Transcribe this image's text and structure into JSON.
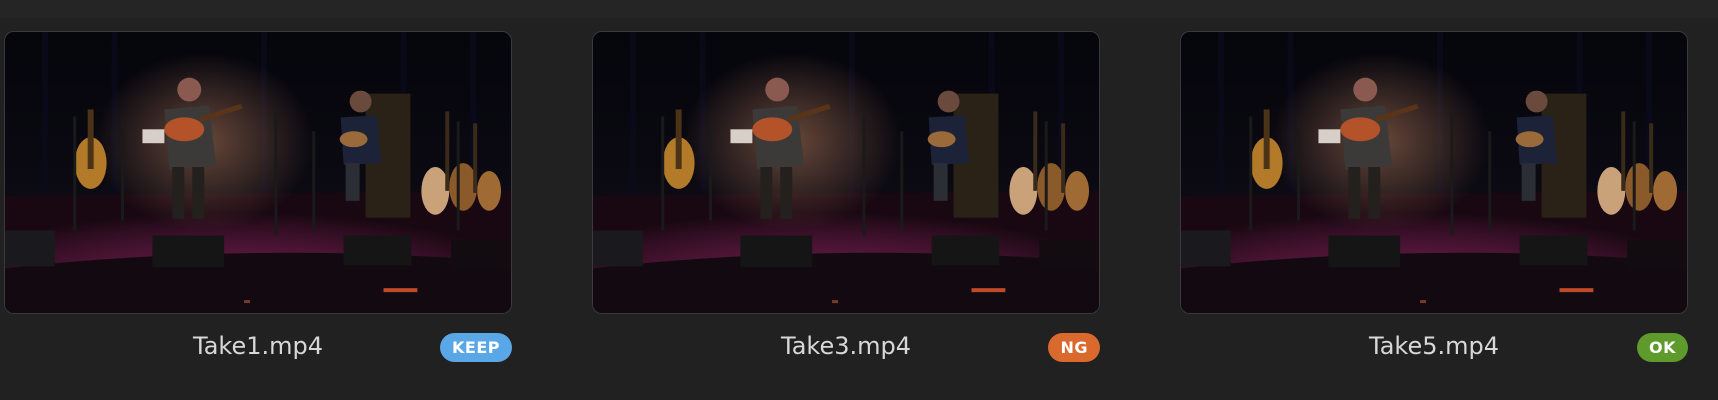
{
  "takes": [
    {
      "filename": "Take1.mp4",
      "badge": {
        "label": "KEEP",
        "color": "#5aa7e8"
      },
      "thumbnail_icon": "concert-stage-thumbnail"
    },
    {
      "filename": "Take3.mp4",
      "badge": {
        "label": "NG",
        "color": "#d9692c"
      },
      "thumbnail_icon": "concert-stage-thumbnail"
    },
    {
      "filename": "Take5.mp4",
      "badge": {
        "label": "OK",
        "color": "#5e9a2c"
      },
      "thumbnail_icon": "concert-stage-thumbnail"
    }
  ],
  "colors": {
    "background": "#212121",
    "filename_text": "#d8d8d8",
    "thumbnail_border": "#3a3a3a"
  }
}
